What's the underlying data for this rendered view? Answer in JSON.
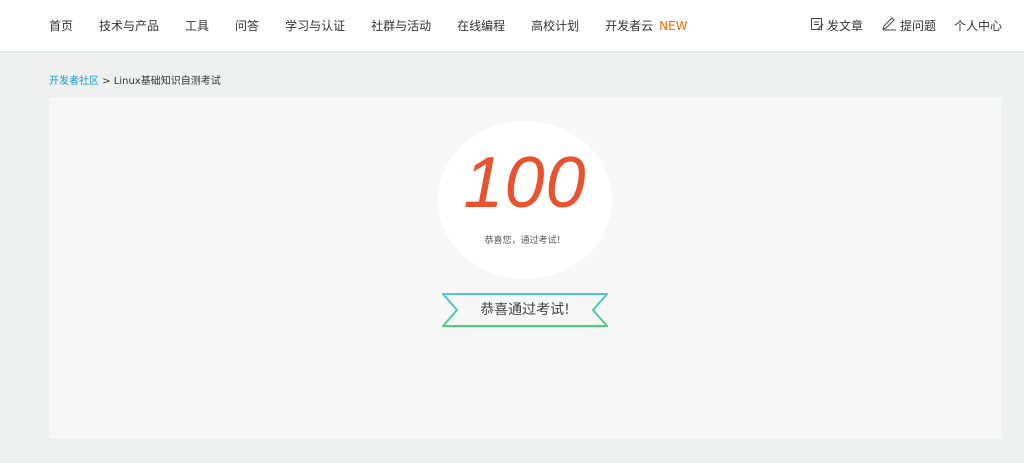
{
  "nav": {
    "items": [
      "首页",
      "技术与产品",
      "工具",
      "问答",
      "学习与认证",
      "社群与活动",
      "在线编程",
      "高校计划",
      "开发者云"
    ],
    "new_badge": "NEW"
  },
  "actions": {
    "write_article": "发文章",
    "ask_question": "提问题",
    "profile": "个人中心"
  },
  "breadcrumb": {
    "root": "开发者社区",
    "separator": " > ",
    "current": "Linux基础知识自测考试"
  },
  "result": {
    "score": "100",
    "message": "恭喜您，通过考试！",
    "ribbon_text": "恭喜通过考试!"
  },
  "colors": {
    "accent": "#e8522e",
    "new_badge": "#ff6a00",
    "link": "#1a9ad6",
    "ribbon_blue": "#4fc3e8",
    "ribbon_green": "#4cd07a"
  }
}
